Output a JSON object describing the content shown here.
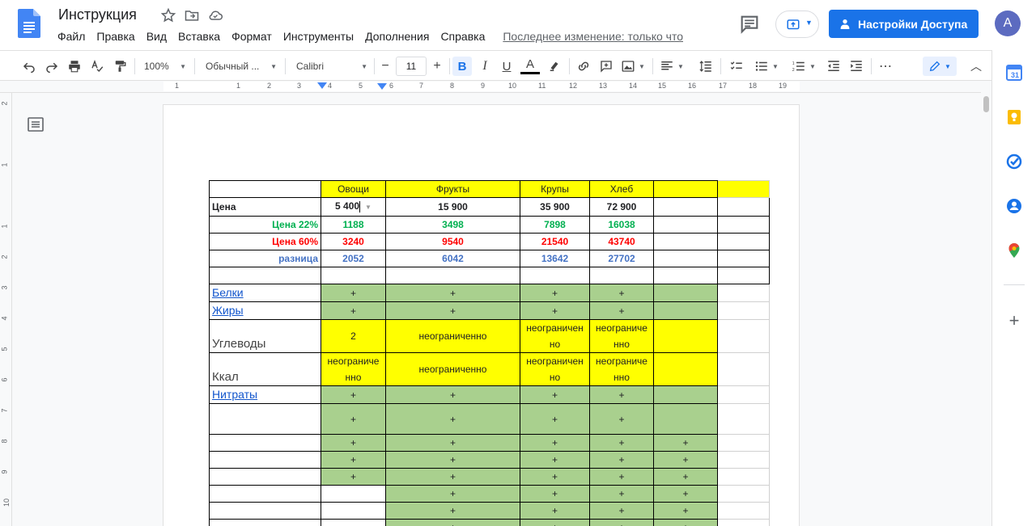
{
  "doc": {
    "title": "Инструкция",
    "menu": [
      "Файл",
      "Правка",
      "Вид",
      "Вставка",
      "Формат",
      "Инструменты",
      "Дополнения",
      "Справка"
    ],
    "last_edit": "Последнее изменение: только что",
    "share_label": "Настройки Доступа",
    "avatar_letter": "A"
  },
  "toolbar": {
    "zoom": "100%",
    "style": "Обычный ...",
    "font": "Calibri",
    "font_size": "11",
    "bold": "B",
    "italic": "I",
    "underline": "U",
    "text_color": "A",
    "more": "⋯"
  },
  "ruler": {
    "h_numbers": [
      "1",
      "1",
      "2",
      "3",
      "4",
      "5",
      "6",
      "7",
      "8",
      "9",
      "10",
      "11",
      "12",
      "13",
      "14",
      "15",
      "16",
      "17",
      "18",
      "19"
    ],
    "v_numbers": [
      "2",
      "1",
      "1",
      "2",
      "3",
      "4",
      "5",
      "6",
      "7",
      "8",
      "9",
      "10"
    ]
  },
  "table": {
    "headers": [
      "",
      "Овощи",
      "Фрукты",
      "Крупы",
      "Хлеб",
      "",
      ""
    ],
    "price_label": "Цена",
    "prices": [
      "5 400",
      "15 900",
      "35 900",
      "72 900"
    ],
    "p22_label": "Цена 22%",
    "p22": [
      "1188",
      "3498",
      "7898",
      "16038"
    ],
    "p60_label": "Цена 60%",
    "p60": [
      "3240",
      "9540",
      "21540",
      "43740"
    ],
    "diff_label": "разница",
    "diff": [
      "2052",
      "6042",
      "13642",
      "27702"
    ],
    "proteins": "Белки",
    "fats": "Жиры",
    "carbs": "Углеводы",
    "kcal": "Ккал",
    "nitrates": "Нитраты",
    "plus": "+",
    "carbs_values": [
      "2",
      "неограниченно",
      "неограничен но",
      "неограниче нно"
    ],
    "kcal_values": [
      "неограниче нно",
      "неограниченно",
      "неограничен но",
      "неограниче нно"
    ]
  },
  "colors": {
    "accent": "#1a73e8",
    "cell_yellow": "#ffff00",
    "cell_green": "#a9d08e",
    "text_green": "#00b050",
    "text_red": "#ff0000",
    "text_blue": "#4472c4"
  }
}
